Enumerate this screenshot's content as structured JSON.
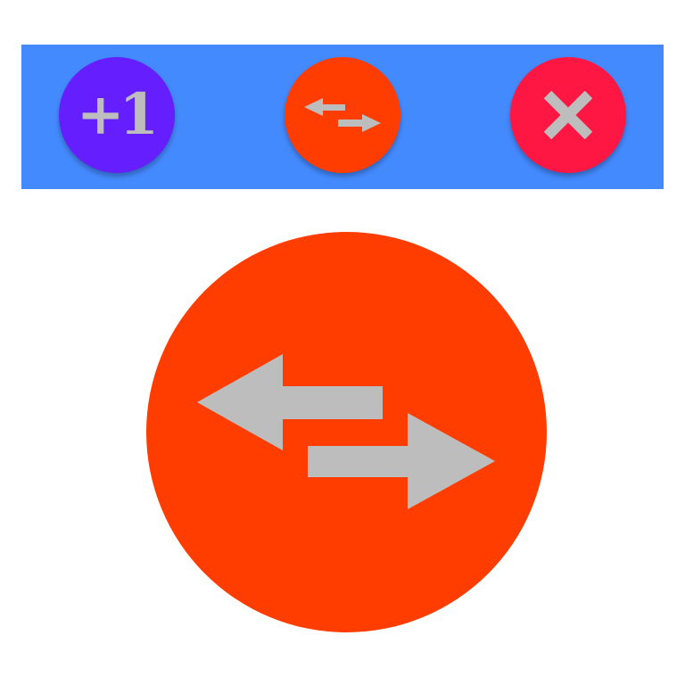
{
  "toolbar": {
    "background": "#448aff",
    "buttons": [
      {
        "name": "plus-one",
        "label": "+1",
        "color": "#651fff",
        "icon": "plus-one-icon"
      },
      {
        "name": "swap",
        "color": "#ff3d00",
        "icon": "swap-horiz-icon"
      },
      {
        "name": "close",
        "color": "#ff1744",
        "icon": "close-icon"
      }
    ]
  },
  "preview": {
    "color": "#ff3d00",
    "icon": "swap-horiz-icon",
    "icon_color": "#bdbdbd"
  }
}
